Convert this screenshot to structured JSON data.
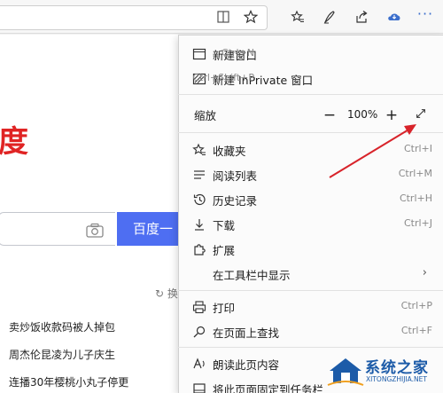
{
  "toolbar": {
    "icons": [
      "reading-view-icon",
      "favorite-star-icon",
      "favorites-list-icon",
      "pen-icon",
      "share-icon",
      "cloud-icon",
      "more-icon"
    ],
    "more_label": "···"
  },
  "page": {
    "brand": "度",
    "search_button": "百度一",
    "refresh_glyph": "↻",
    "refresh_text": "换",
    "news": [
      "卖炒饭收款码被人掉包",
      "周杰伦昆凌为儿子庆生",
      "连播30年樱桃小丸子停更"
    ]
  },
  "menu": {
    "new_window": {
      "label": "新建窗口",
      "shortcut": "Ctrl+N",
      "icon": "window-icon"
    },
    "inprivate": {
      "label": "新建 InPrivate 窗口",
      "shortcut": "Ctrl+Shift+P",
      "icon": "inprivate-icon"
    },
    "zoom": {
      "label": "缩放",
      "minus": "−",
      "value": "100%",
      "plus": "+",
      "fullscreen_icon": "expand-icon"
    },
    "items": [
      {
        "label": "收藏夹",
        "shortcut": "Ctrl+I",
        "icon": "star-list-icon"
      },
      {
        "label": "阅读列表",
        "shortcut": "Ctrl+M",
        "icon": "reading-list-icon"
      },
      {
        "label": "历史记录",
        "shortcut": "Ctrl+H",
        "icon": "history-icon"
      },
      {
        "label": "下载",
        "shortcut": "Ctrl+J",
        "icon": "download-icon"
      },
      {
        "label": "扩展",
        "shortcut": "",
        "icon": "puzzle-icon"
      },
      {
        "label": "在工具栏中显示",
        "shortcut": "",
        "icon": ""
      }
    ],
    "print": {
      "label": "打印",
      "shortcut": "Ctrl+P",
      "icon": "print-icon"
    },
    "find": {
      "label": "在页面上查找",
      "shortcut": "Ctrl+F",
      "icon": "search-icon"
    },
    "read_aloud": {
      "label": "朗读此页内容",
      "icon": "read-aloud-icon"
    },
    "pin": {
      "label": "将此页面固定到任务栏",
      "icon": "pin-icon"
    },
    "chevron": "›"
  },
  "watermark": {
    "title": "系统之家",
    "sub": "XITONGZHIJIA.NET"
  },
  "colors": {
    "accent_blue": "#3b6ecc",
    "baidu_red": "#e02424",
    "search_btn": "#4e6ef2",
    "arrow_red": "#d8232a"
  }
}
